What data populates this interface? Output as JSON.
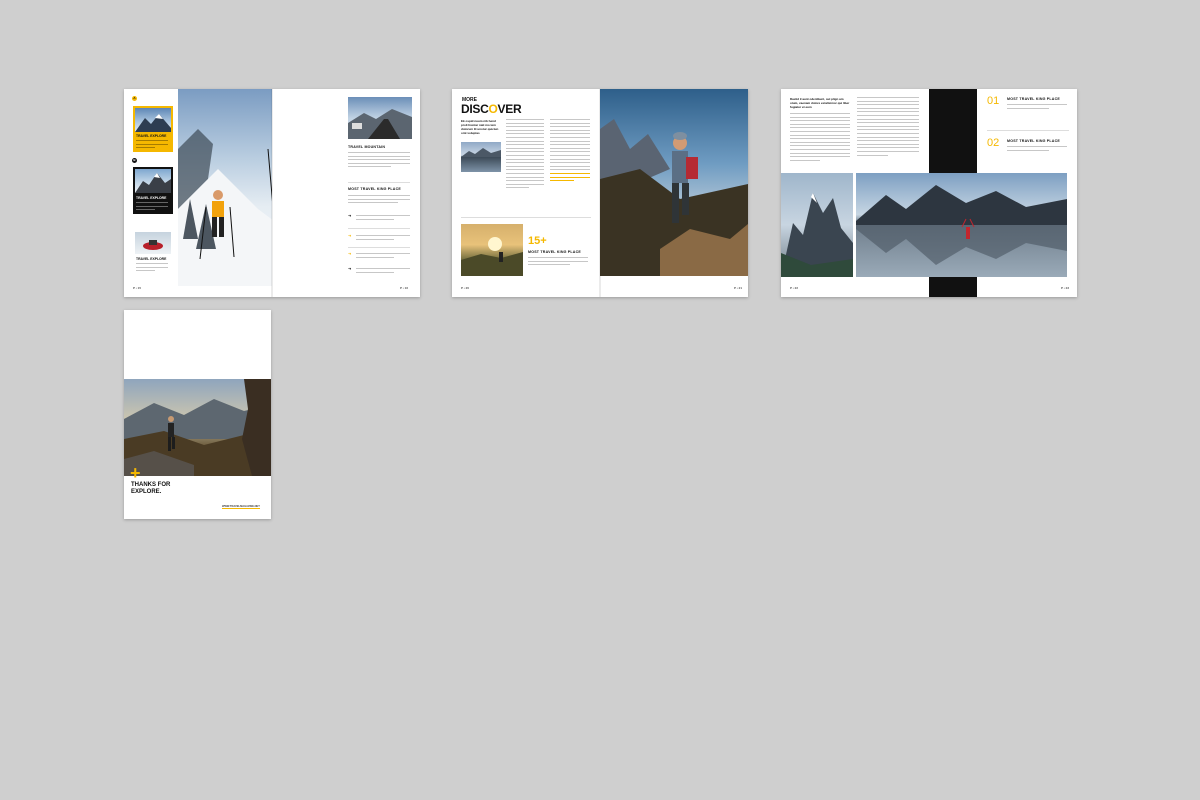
{
  "colors": {
    "background": "#cfcfcf",
    "accent": "#f5b800",
    "page": "#ffffff",
    "dark": "#111111"
  },
  "spread1": {
    "page_left_folio": "P • 15",
    "page_right_folio": "P • 16",
    "badge_1": "A",
    "badge_2": "B",
    "card_1_label": "TRAVEL EXPLORE",
    "card_2_label": "TRAVEL EXPLORE",
    "card_3_label": "TRAVEL EXPLORE",
    "right_heading_1": "TRAVEL MOUNTAIN",
    "right_heading_2": "MOST TRAVEL KING PLACE"
  },
  "spread2": {
    "kicker": "MORE",
    "title_part_1": "DISC",
    "title_highlight": "O",
    "title_part_2": "VER",
    "intro": "Ek ospid nuum nib hend proli lisiotar nati mo tem dolorum lit unotur quiciun omt voluptas",
    "stat_number": "15+",
    "stat_label": "MOST TRAVEL KING PLACE",
    "folio_left": "P • 20",
    "folio_right": "P • 21"
  },
  "spread3": {
    "intro": "Daciid il aunt odentbunt, sut plign am otum, caenam dolore estalisimor qui liber fugiatur et eum",
    "item_1_number": "01",
    "item_1_title": "MOST TRAVEL KING PLACE",
    "item_2_number": "02",
    "item_2_title": "MOST TRAVEL KING PLACE",
    "folio_left": "P • 22",
    "folio_right": "P • 23"
  },
  "back_cover": {
    "plus": "+",
    "title_line_1": "THANKS FOR",
    "title_line_2": "EXPLORE.",
    "website": "WWW.TRAVELMAGAZINE.NET"
  }
}
